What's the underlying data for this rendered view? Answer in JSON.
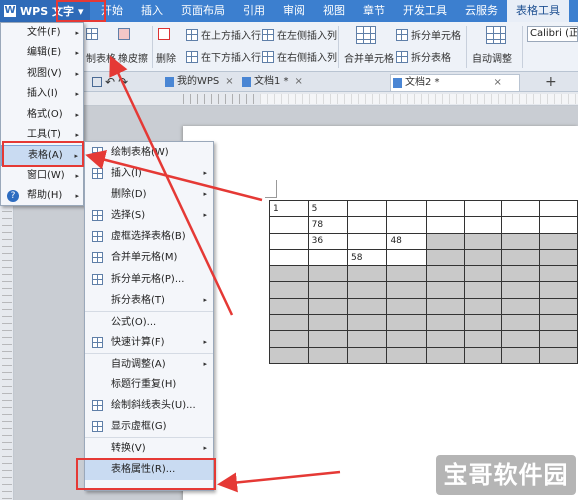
{
  "app": {
    "title": "WPS 文字",
    "dropdown_glyph": "▾"
  },
  "ribbon_tabs": [
    "开始",
    "插入",
    "页面布局",
    "引用",
    "审阅",
    "视图",
    "章节",
    "开发工具",
    "云服务",
    "表格工具"
  ],
  "ribbon": {
    "draw_table": "制表格",
    "eraser": "橡皮擦",
    "delete": "删除",
    "insert_above": "在上方插入行",
    "insert_left": "在左侧插入列",
    "insert_below": "在下方插入行",
    "insert_right": "在右侧插入列",
    "merge_cells": "合并单元格",
    "split_cells": "拆分单元格",
    "split_table": "拆分表格",
    "auto_fit": "自动调整",
    "font": "Calibri (正文"
  },
  "doc_tabs": [
    {
      "label": "我的WPS",
      "close": "×"
    },
    {
      "label": "文档1 *",
      "close": "×"
    },
    {
      "label": "文档2 *",
      "close": "×"
    }
  ],
  "doc_plus": "+",
  "main_menu": [
    {
      "label": "文件(F)",
      "arrow": "▸"
    },
    {
      "label": "编辑(E)",
      "arrow": "▸"
    },
    {
      "label": "视图(V)",
      "arrow": "▸"
    },
    {
      "label": "插入(I)",
      "arrow": "▸"
    },
    {
      "label": "格式(O)",
      "arrow": "▸"
    },
    {
      "label": "工具(T)",
      "arrow": "▸"
    },
    {
      "label": "表格(A)",
      "arrow": "▸"
    },
    {
      "label": "窗口(W)",
      "arrow": "▸"
    },
    {
      "label": "帮助(H)",
      "arrow": "▸"
    }
  ],
  "sub_menu": [
    {
      "label": "绘制表格(W)",
      "arrow": ""
    },
    {
      "label": "插入(I)",
      "arrow": "▸"
    },
    {
      "label": "删除(D)",
      "arrow": "▸"
    },
    {
      "label": "选择(S)",
      "arrow": "▸"
    },
    {
      "label": "虚框选择表格(B)",
      "arrow": ""
    },
    {
      "label": "合并单元格(M)",
      "arrow": ""
    },
    {
      "label": "拆分单元格(P)...",
      "arrow": ""
    },
    {
      "label": "拆分表格(T)",
      "arrow": "▸"
    },
    {
      "label": "公式(O)...",
      "arrow": ""
    },
    {
      "label": "快速计算(F)",
      "arrow": "▸"
    },
    {
      "label": "自动调整(A)",
      "arrow": "▸"
    },
    {
      "label": "标题行重复(H)",
      "arrow": ""
    },
    {
      "label": "绘制斜线表头(U)...",
      "arrow": ""
    },
    {
      "label": "显示虚框(G)",
      "arrow": ""
    },
    {
      "label": "转换(V)",
      "arrow": "▸"
    },
    {
      "label": "表格属性(R)...",
      "arrow": ""
    }
  ],
  "table": {
    "rows": [
      [
        "1",
        "5",
        "",
        "",
        "",
        "",
        "",
        ""
      ],
      [
        "",
        "78",
        "",
        "",
        "",
        "",
        "",
        ""
      ],
      [
        "",
        "36",
        "",
        "48",
        "",
        "",
        "",
        ""
      ],
      [
        "",
        "",
        "58",
        "",
        "",
        "",
        "",
        ""
      ],
      [
        "",
        "",
        "",
        "",
        "",
        "",
        "",
        ""
      ],
      [
        "",
        "",
        "",
        "",
        "",
        "",
        "",
        ""
      ],
      [
        "",
        "",
        "",
        "",
        "",
        "",
        "",
        ""
      ],
      [
        "",
        "",
        "",
        "",
        "",
        "",
        "",
        ""
      ],
      [
        "",
        "",
        "",
        "",
        "",
        "",
        "",
        ""
      ],
      [
        "",
        "",
        "",
        "",
        "",
        "",
        "",
        ""
      ]
    ]
  },
  "watermark": "宝哥软件园",
  "colors": {
    "annotation": "#e53935",
    "accent": "#3c7fcf"
  }
}
